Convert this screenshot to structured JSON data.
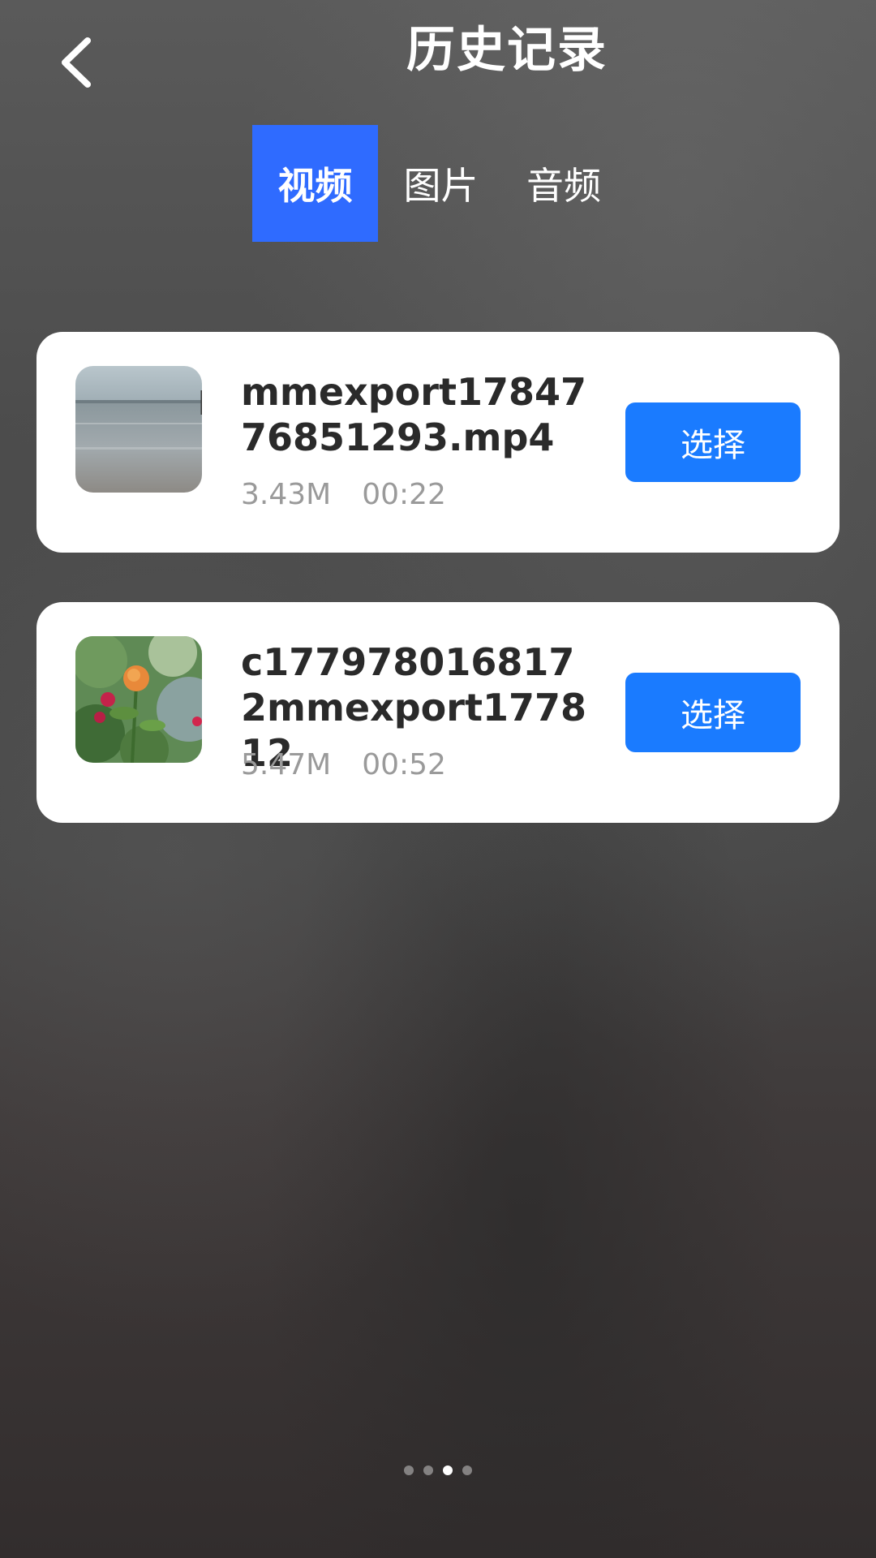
{
  "header": {
    "title": "历史记录",
    "back_icon": "chevron-left-icon"
  },
  "tabs": [
    {
      "label": "视频",
      "active": true
    },
    {
      "label": "图片",
      "active": false
    },
    {
      "label": "音频",
      "active": false
    }
  ],
  "items": [
    {
      "name": "mmexport1784776851293.mp4",
      "size": "3.43M",
      "duration": "00:22",
      "select_label": "选择"
    },
    {
      "name": "c1779780168172mmexport177812",
      "size": "5.47M",
      "duration": "00:52",
      "select_label": "选择"
    }
  ],
  "pager": {
    "count": 4,
    "active_index": 2
  },
  "colors": {
    "accent": "#1a7bff",
    "tab_active": "#2f6bff"
  }
}
